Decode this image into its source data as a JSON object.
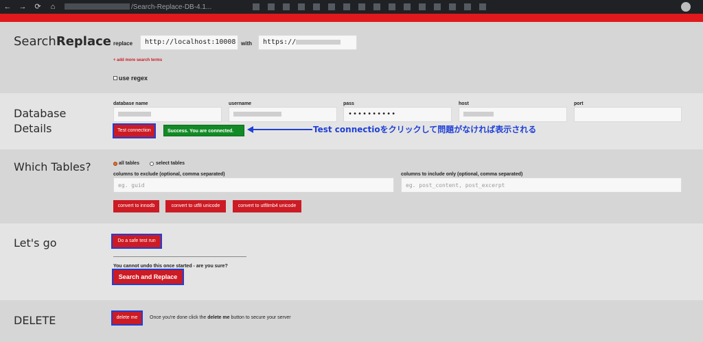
{
  "browser": {
    "back_icon": "←",
    "forward_icon": "→",
    "reload_icon": "⟳",
    "home_icon": "⌂",
    "url_tail": "/Search-Replace-DB-4.1..."
  },
  "brand": {
    "light": "Search",
    "bold": "Replace"
  },
  "replace": {
    "replace_label": "replace",
    "replace_value": "http://localhost:10008",
    "with_label": "with",
    "with_value": "https://",
    "add_more": "+ add more search terms",
    "regex_label": "use regex"
  },
  "database": {
    "title_line1": "Database",
    "title_line2": "Details",
    "name_label": "database name",
    "username_label": "username",
    "pass_label": "pass",
    "pass_value": "••••••••••",
    "host_label": "host",
    "port_label": "port",
    "test_button": "Test connection",
    "success_text": "Success. You are connected."
  },
  "annotation": {
    "text": "Test connectioをクリックして問題がなければ表示される",
    "color": "#1f3fd6"
  },
  "tables": {
    "title": "Which Tables?",
    "all_tables": "all tables",
    "select_tables": "select tables",
    "exclude_label": "columns to exclude (optional, comma separated)",
    "exclude_placeholder": "eg. guid",
    "include_label": "columns to include only (optional, comma separated)",
    "include_placeholder": "eg. post_content, post_excerpt",
    "btn_innodb": "convert to innodb",
    "btn_utf8": "convert to utf8 unicode",
    "btn_utf8mb4": "convert to utf8mb4 unicode"
  },
  "letsgo": {
    "title": "Let's go",
    "dry_run": "Do a safe test run",
    "warning": "You cannot undo this once started - are you sure?",
    "search_replace": "Search and Replace"
  },
  "delete": {
    "title": "DELETE",
    "button": "delete me",
    "note_before": "Once you're done click the ",
    "note_bold": "delete me",
    "note_after": " button to secure your server"
  },
  "colors": {
    "accent_red": "#cc1b24",
    "success_green": "#128a26",
    "highlight_blue": "#1f3fd6"
  }
}
